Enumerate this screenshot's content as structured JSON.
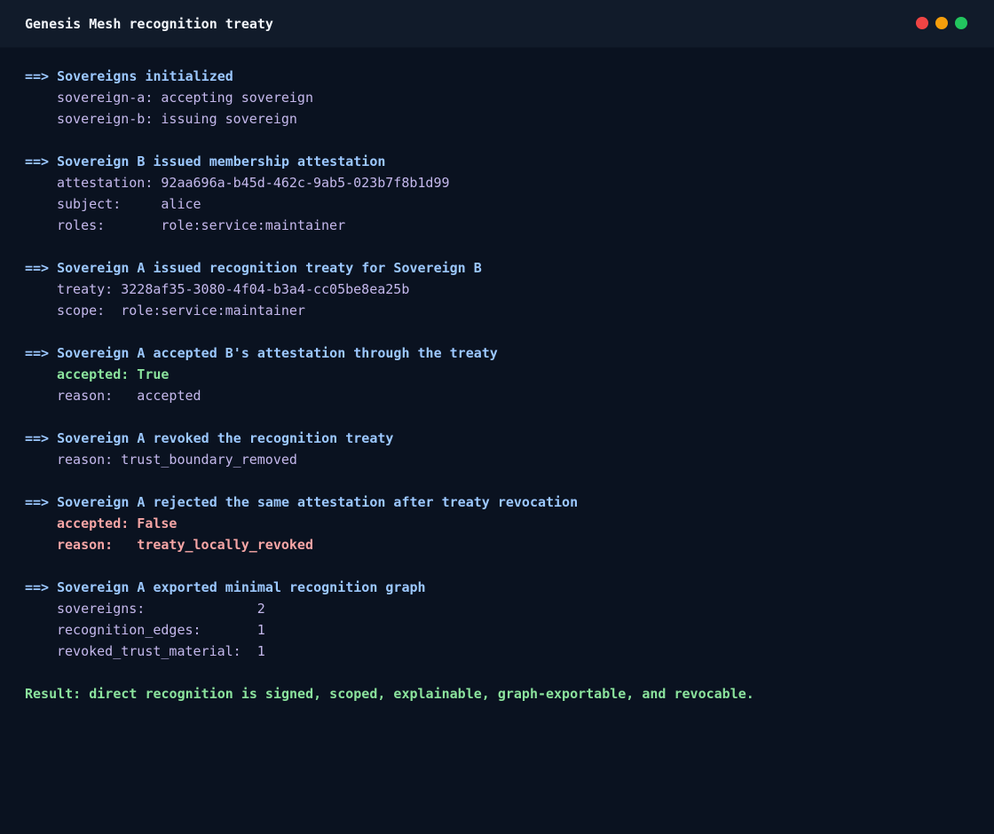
{
  "window": {
    "title": "Genesis Mesh recognition treaty",
    "controls": [
      "close-dot",
      "minimize-dot",
      "maximize-dot"
    ],
    "colors": {
      "background": "#0a1220",
      "titlebar": "#111b2a",
      "heading": "#9cc8ff",
      "detail": "#c4b8ec",
      "success": "#8be39d",
      "error": "#f7a6a6"
    }
  },
  "sections": [
    {
      "heading": "==> Sovereigns initialized",
      "lines": [
        "sovereign-a: accepting sovereign",
        "sovereign-b: issuing sovereign"
      ]
    },
    {
      "heading": "==> Sovereign B issued membership attestation",
      "lines": [
        "attestation: 92aa696a-b45d-462c-9ab5-023b7f8b1d99",
        "subject:     alice",
        "roles:       role:service:maintainer"
      ]
    },
    {
      "heading": "==> Sovereign A issued recognition treaty for Sovereign B",
      "lines": [
        "treaty: 3228af35-3080-4f04-b3a4-cc05be8ea25b",
        "scope:  role:service:maintainer"
      ]
    },
    {
      "heading": "==> Sovereign A accepted B's attestation through the treaty",
      "lines": [
        "accepted: True",
        "reason:   accepted"
      ]
    },
    {
      "heading": "==> Sovereign A revoked the recognition treaty",
      "lines": [
        "reason: trust_boundary_removed"
      ]
    },
    {
      "heading": "==> Sovereign A rejected the same attestation after treaty revocation",
      "lines": [
        "accepted: False",
        "reason:   treaty_locally_revoked"
      ]
    },
    {
      "heading": "==> Sovereign A exported minimal recognition graph",
      "lines": [
        "sovereigns:              2",
        "recognition_edges:       1",
        "revoked_trust_material:  1"
      ]
    }
  ],
  "result": "Result: direct recognition is signed, scoped, explainable, graph-exportable, and revocable."
}
